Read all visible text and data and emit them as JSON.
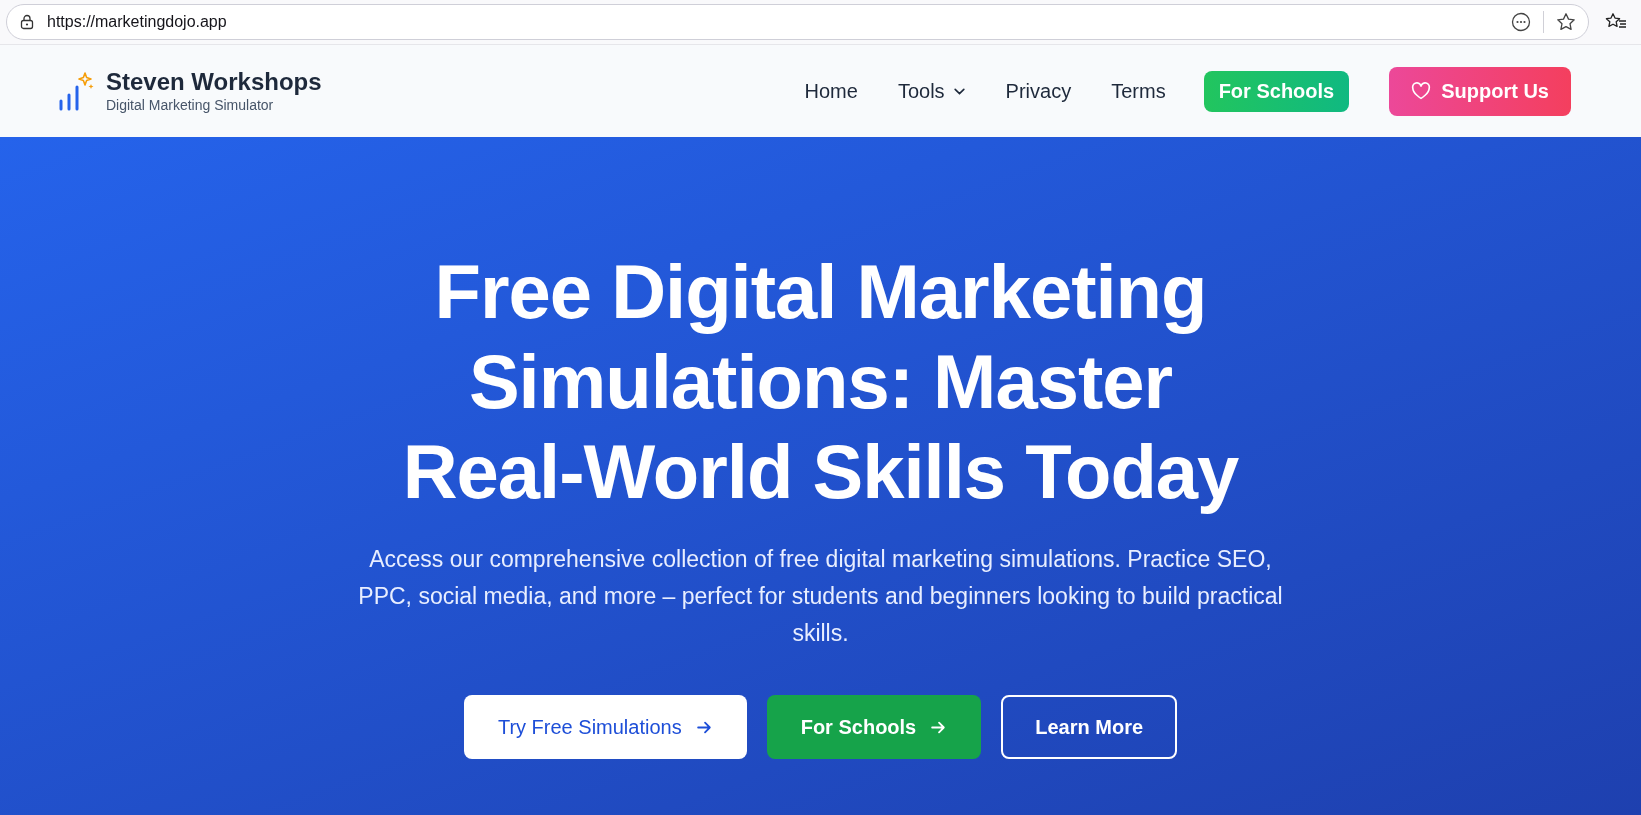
{
  "browser": {
    "url": "https://marketingdojo.app"
  },
  "header": {
    "brand": {
      "title": "Steven Workshops",
      "subtitle": "Digital Marketing Simulator"
    },
    "nav": [
      {
        "label": "Home",
        "kind": "link"
      },
      {
        "label": "Tools",
        "kind": "dropdown"
      },
      {
        "label": "Privacy",
        "kind": "link"
      },
      {
        "label": "Terms",
        "kind": "link"
      },
      {
        "label": "For Schools",
        "kind": "green"
      },
      {
        "label": "Support Us",
        "kind": "pink"
      }
    ]
  },
  "hero": {
    "title": "Free Digital Marketing Simulations: Master Real-World Skills Today",
    "subtitle": "Access our comprehensive collection of free digital marketing simulations. Practice SEO, PPC, social media, and more – perfect for students and beginners looking to build practical skills.",
    "buttons": [
      {
        "label": "Try Free Simulations",
        "kind": "primary"
      },
      {
        "label": "For Schools",
        "kind": "green"
      },
      {
        "label": "Learn More",
        "kind": "outline"
      }
    ]
  }
}
